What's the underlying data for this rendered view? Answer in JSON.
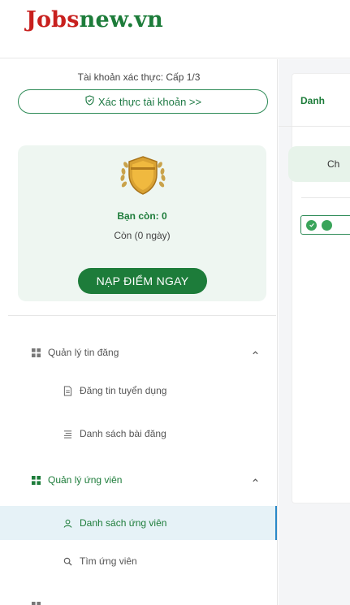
{
  "header": {
    "logo_part1": "Jobs",
    "logo_part2": "new.vn"
  },
  "account": {
    "verify_label": "Tài khoản xác thực: Cấp 1/3",
    "verify_button": "Xác thực tài khoản >>"
  },
  "balance": {
    "remain_label": "Bạn còn: 0",
    "remain_days": "Còn (0 ngày)",
    "topup_button": "NẠP ĐIỂM NGAY"
  },
  "menu": {
    "posts": {
      "label": "Quản lý tin đăng",
      "items": [
        {
          "label": "Đăng tin tuyển dụng"
        },
        {
          "label": "Danh sách bài đăng"
        }
      ]
    },
    "candidates": {
      "label": "Quản lý ứng viên",
      "items": [
        {
          "label": "Danh sách ứng viên"
        },
        {
          "label": "Tìm ứng viên"
        }
      ]
    }
  },
  "main": {
    "panel_title": "Danh",
    "tab_label": "Ch"
  },
  "colors": {
    "brand_red": "#c8201e",
    "brand_green": "#1d7c3a",
    "active_bg": "#e6f2f7",
    "active_border": "#2a88c8"
  }
}
